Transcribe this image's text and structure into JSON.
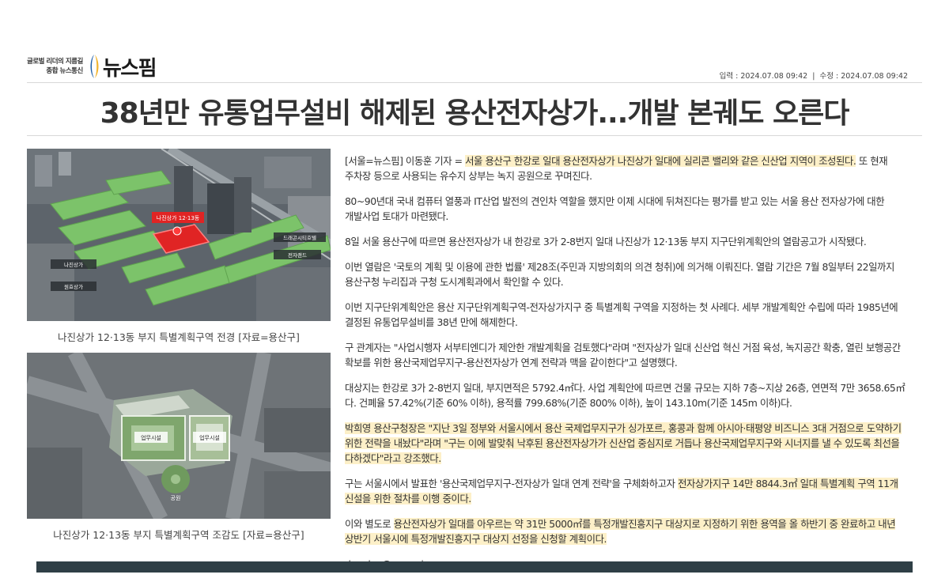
{
  "brand": {
    "tagline_1": "글로벌 리더의 지름길",
    "tagline_2": "종합 뉴스통신",
    "name": "뉴스핌"
  },
  "meta": {
    "input": "입력 : 2024.07.08 09:42",
    "separator": "|",
    "modified": "수정 : 2024.07.08 09:42"
  },
  "headline": "38년만 유통업무설비 해제된 용산전자상가...개발 본궤도 오른다",
  "images": [
    {
      "caption": "나진상가 12·13동 부지 특별계획구역 전경 [자료=용산구]",
      "labels": {
        "main_tag": "나진상가 12·13동",
        "dream_hub": "드래곤시티호텔",
        "najin_1": "나진상가",
        "najin_2": "원효상가",
        "tech_land": "전자랜드"
      }
    },
    {
      "caption": "나진상가 12·13동 부지 특별계획구역 조감도 [자료=용산구]",
      "labels": {
        "block_a": "업무시설",
        "block_b": "업무시설",
        "park": "공원"
      }
    }
  ],
  "article": {
    "p1": {
      "lead": "[서울=뉴스핌] 이동훈 기자 = ",
      "hl": "서울 용산구 한강로 일대 용산전자상가 나진상가 일대에 실리콘 밸리와 같은 신산업 지역이 조성된다.",
      "rest": " 또 현재 주차장 등으로 사용되는 유수지 상부는 녹지 공원으로 꾸며진다."
    },
    "p2": "80~90년대 국내 컴퓨터 열풍과 IT산업 발전의 견인차 역할을 했지만 이제 시대에 뒤쳐진다는 평가를 받고 있는 서울 용산 전자상가에 대한 개발사업 토대가 마련됐다.",
    "p3": "8일 서울 용산구에 따르면 용산전자상가 내 한강로 3가 2-8번지 일대 나진상가 12·13동 부지 지구단위계획안의 열람공고가 시작됐다.",
    "p4": "이번 열람은 '국토의 계획 및 이용에 관한 법률' 제28조(주민과 지방의회의 의견 청취)에 의거해 이뤄진다. 열람 기간은 7월 8일부터 22일까지 용산구청 누리집과 구청 도시계획과에서 확인할 수 있다.",
    "p5": "이번 지구단위계획안은 용산 지구단위계획구역-전자상가지구 중 특별계획 구역을 지정하는 첫 사례다. 세부 개발계획안 수립에 따라 1985년에 결정된 유통업무설비를 38년 만에 해제한다.",
    "p6": "구 관계자는 \"사업시행자 서부티엔디가 제안한 개발계획을 검토했다\"라며 \"전자상가 일대 신산업 혁신 거점 육성, 녹지공간 확충, 열린 보행공간 확보를 위한 용산국제업무지구-용산전자상가 연계 전략과 맥을 같이한다\"고 설명했다.",
    "p7": "대상지는 한강로 3가 2-8번지 일대, 부지면적은 5792.4㎡다. 사업 계획안에 따르면 건물 규모는 지하 7층~지상 26층, 연면적 7만 3658.65㎡다. 건폐율 57.42%(기준 60% 이하), 용적률 799.68%(기준 800% 이하), 높이 143.10m(기준 145m 이하)다.",
    "p8": "박희영 용산구청장은 \"지난 3일 정부와 서울시에서 용산 국제업무지구가 싱가포르, 홍콩과 함께 아시아·태평양 비즈니스 3대 거점으로 도약하기 위한 전략을 내놨다\"라며 \"구는 이에 발맞춰 낙후된 용산전자상가가 신산업 중심지로 거듭나 용산국제업무지구와 시너지를 낼 수 있도록 최선을 다하겠다\"라고 강조했다.",
    "p9": {
      "lead": "구는 서울시에서 발표한 '용산국제업무지구-전자상가 일대 연계 전략'을 구체화하고자 ",
      "hl": "전자상가지구 14만 8844.3㎡ 일대 특별계획 구역 11개 신설을 위한 절차를 이행 중이다."
    },
    "p10": {
      "lead": "이와 별도로 ",
      "hl": "용산전자상가 일대를 아우르는 약 31만 5000㎡를 특정개발진흥지구 대상지로 지정하기 위한 용역을 올 하반기 중 완료하고 내년 상반기 서울시에 특정개발진흥지구 대상지 선정을 신청할 계획이다."
    },
    "email": "donglee@newspim.com"
  },
  "colors": {
    "highlight": "#fdf0c8",
    "footer_bar": "#2f3f46",
    "brand_blue": "#1f5fa8",
    "brand_yellow": "#f2b531",
    "roof_green": "#7cc36a",
    "site_red": "#e02424"
  }
}
